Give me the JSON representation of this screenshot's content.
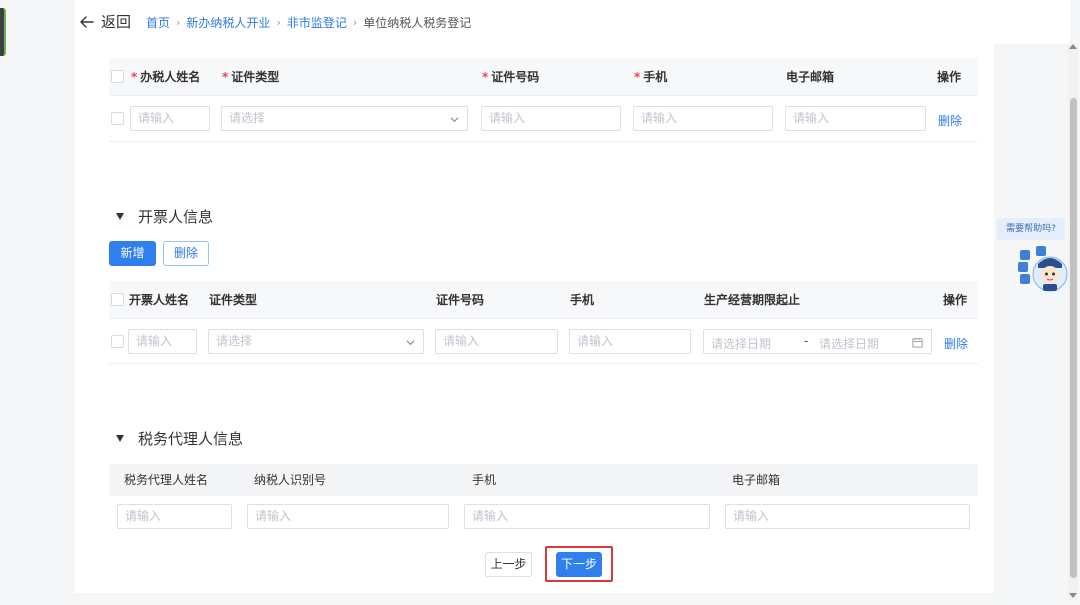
{
  "header": {
    "back_label": "返回",
    "breadcrumb": [
      "首页",
      "新办纳税人开业",
      "非市监登记"
    ],
    "current": "单位纳税人税务登记",
    "separator": "›"
  },
  "banshui": {
    "columns": {
      "name": "办税人姓名",
      "id_type": "证件类型",
      "id_no": "证件号码",
      "phone": "手机",
      "email": "电子邮箱",
      "action": "操作"
    },
    "required_mark": "*",
    "row": {
      "name_ph": "请输入",
      "id_type_ph": "请选择",
      "id_no_ph": "请输入",
      "phone_ph": "请输入",
      "email_ph": "请输入",
      "delete": "删除"
    }
  },
  "kaipiao": {
    "title": "开票人信息",
    "add_label": "新增",
    "delete_label": "删除",
    "columns": {
      "name": "开票人姓名",
      "id_type": "证件类型",
      "id_no": "证件号码",
      "phone": "手机",
      "period": "生产经营期限起止",
      "action": "操作"
    },
    "row": {
      "name_ph": "请输入",
      "id_type_ph": "请选择",
      "id_no_ph": "请输入",
      "phone_ph": "请输入",
      "start_ph": "请选择日期",
      "range_sep": "-",
      "end_ph": "请选择日期",
      "delete": "删除"
    }
  },
  "agent": {
    "title": "税务代理人信息",
    "columns": {
      "name": "税务代理人姓名",
      "taxpayer_id": "纳税人识别号",
      "phone": "手机",
      "email": "电子邮箱"
    },
    "row": {
      "name_ph": "请输入",
      "taxpayer_id_ph": "请输入",
      "phone_ph": "请输入",
      "email_ph": "请输入"
    }
  },
  "footer": {
    "prev_label": "上一步",
    "next_label": "下一步"
  },
  "assistant": {
    "bubble": "需要帮助吗?"
  },
  "colors": {
    "primary": "#2f80ed",
    "link": "#2f7ae5",
    "required": "#e5484d",
    "highlight": "#d9363e"
  }
}
